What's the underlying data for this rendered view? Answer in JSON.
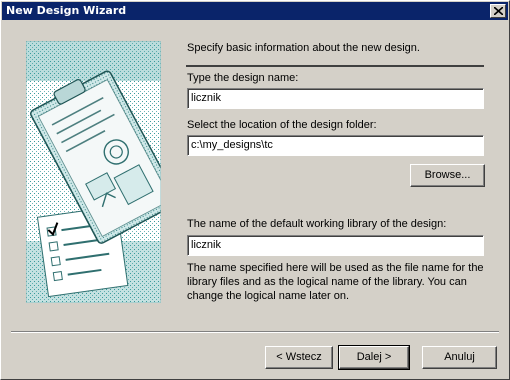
{
  "window": {
    "title": "New Design Wizard",
    "close_symbol": "×"
  },
  "intro": "Specify basic information about the new design.",
  "design_name": {
    "label": "Type the design name:",
    "value": "licznik"
  },
  "location": {
    "label": "Select the location of the design folder:",
    "value": "c:\\my_designs\\tc",
    "browse_label": "Browse..."
  },
  "library": {
    "label": "The name of the default working library of the design:",
    "value": "licznik",
    "description": "The name specified here will be used as the file name for the library files and as the logical name of the library. You can change the logical name later on."
  },
  "buttons": {
    "back": "< Wstecz",
    "next": "Dalej >",
    "cancel": "Anuluj"
  },
  "illustration": {
    "icon": "clipboard-illustration",
    "accent_color": "#3a9a9a"
  }
}
